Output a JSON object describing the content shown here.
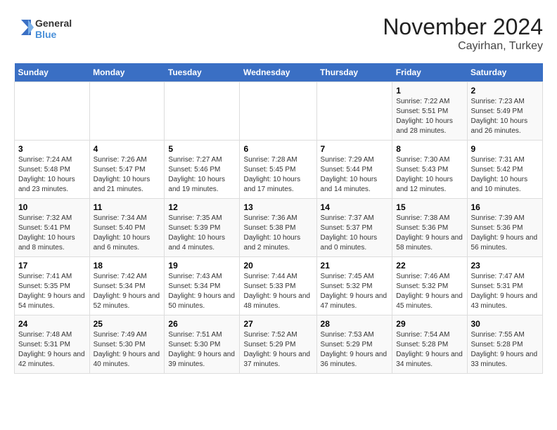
{
  "header": {
    "logo_general": "General",
    "logo_blue": "Blue",
    "month": "November 2024",
    "location": "Cayirhan, Turkey"
  },
  "calendar": {
    "days_of_week": [
      "Sunday",
      "Monday",
      "Tuesday",
      "Wednesday",
      "Thursday",
      "Friday",
      "Saturday"
    ],
    "weeks": [
      [
        {
          "day": "",
          "info": ""
        },
        {
          "day": "",
          "info": ""
        },
        {
          "day": "",
          "info": ""
        },
        {
          "day": "",
          "info": ""
        },
        {
          "day": "",
          "info": ""
        },
        {
          "day": "1",
          "info": "Sunrise: 7:22 AM\nSunset: 5:51 PM\nDaylight: 10 hours and 28 minutes."
        },
        {
          "day": "2",
          "info": "Sunrise: 7:23 AM\nSunset: 5:49 PM\nDaylight: 10 hours and 26 minutes."
        }
      ],
      [
        {
          "day": "3",
          "info": "Sunrise: 7:24 AM\nSunset: 5:48 PM\nDaylight: 10 hours and 23 minutes."
        },
        {
          "day": "4",
          "info": "Sunrise: 7:26 AM\nSunset: 5:47 PM\nDaylight: 10 hours and 21 minutes."
        },
        {
          "day": "5",
          "info": "Sunrise: 7:27 AM\nSunset: 5:46 PM\nDaylight: 10 hours and 19 minutes."
        },
        {
          "day": "6",
          "info": "Sunrise: 7:28 AM\nSunset: 5:45 PM\nDaylight: 10 hours and 17 minutes."
        },
        {
          "day": "7",
          "info": "Sunrise: 7:29 AM\nSunset: 5:44 PM\nDaylight: 10 hours and 14 minutes."
        },
        {
          "day": "8",
          "info": "Sunrise: 7:30 AM\nSunset: 5:43 PM\nDaylight: 10 hours and 12 minutes."
        },
        {
          "day": "9",
          "info": "Sunrise: 7:31 AM\nSunset: 5:42 PM\nDaylight: 10 hours and 10 minutes."
        }
      ],
      [
        {
          "day": "10",
          "info": "Sunrise: 7:32 AM\nSunset: 5:41 PM\nDaylight: 10 hours and 8 minutes."
        },
        {
          "day": "11",
          "info": "Sunrise: 7:34 AM\nSunset: 5:40 PM\nDaylight: 10 hours and 6 minutes."
        },
        {
          "day": "12",
          "info": "Sunrise: 7:35 AM\nSunset: 5:39 PM\nDaylight: 10 hours and 4 minutes."
        },
        {
          "day": "13",
          "info": "Sunrise: 7:36 AM\nSunset: 5:38 PM\nDaylight: 10 hours and 2 minutes."
        },
        {
          "day": "14",
          "info": "Sunrise: 7:37 AM\nSunset: 5:37 PM\nDaylight: 10 hours and 0 minutes."
        },
        {
          "day": "15",
          "info": "Sunrise: 7:38 AM\nSunset: 5:36 PM\nDaylight: 9 hours and 58 minutes."
        },
        {
          "day": "16",
          "info": "Sunrise: 7:39 AM\nSunset: 5:36 PM\nDaylight: 9 hours and 56 minutes."
        }
      ],
      [
        {
          "day": "17",
          "info": "Sunrise: 7:41 AM\nSunset: 5:35 PM\nDaylight: 9 hours and 54 minutes."
        },
        {
          "day": "18",
          "info": "Sunrise: 7:42 AM\nSunset: 5:34 PM\nDaylight: 9 hours and 52 minutes."
        },
        {
          "day": "19",
          "info": "Sunrise: 7:43 AM\nSunset: 5:34 PM\nDaylight: 9 hours and 50 minutes."
        },
        {
          "day": "20",
          "info": "Sunrise: 7:44 AM\nSunset: 5:33 PM\nDaylight: 9 hours and 48 minutes."
        },
        {
          "day": "21",
          "info": "Sunrise: 7:45 AM\nSunset: 5:32 PM\nDaylight: 9 hours and 47 minutes."
        },
        {
          "day": "22",
          "info": "Sunrise: 7:46 AM\nSunset: 5:32 PM\nDaylight: 9 hours and 45 minutes."
        },
        {
          "day": "23",
          "info": "Sunrise: 7:47 AM\nSunset: 5:31 PM\nDaylight: 9 hours and 43 minutes."
        }
      ],
      [
        {
          "day": "24",
          "info": "Sunrise: 7:48 AM\nSunset: 5:31 PM\nDaylight: 9 hours and 42 minutes."
        },
        {
          "day": "25",
          "info": "Sunrise: 7:49 AM\nSunset: 5:30 PM\nDaylight: 9 hours and 40 minutes."
        },
        {
          "day": "26",
          "info": "Sunrise: 7:51 AM\nSunset: 5:30 PM\nDaylight: 9 hours and 39 minutes."
        },
        {
          "day": "27",
          "info": "Sunrise: 7:52 AM\nSunset: 5:29 PM\nDaylight: 9 hours and 37 minutes."
        },
        {
          "day": "28",
          "info": "Sunrise: 7:53 AM\nSunset: 5:29 PM\nDaylight: 9 hours and 36 minutes."
        },
        {
          "day": "29",
          "info": "Sunrise: 7:54 AM\nSunset: 5:28 PM\nDaylight: 9 hours and 34 minutes."
        },
        {
          "day": "30",
          "info": "Sunrise: 7:55 AM\nSunset: 5:28 PM\nDaylight: 9 hours and 33 minutes."
        }
      ]
    ]
  }
}
